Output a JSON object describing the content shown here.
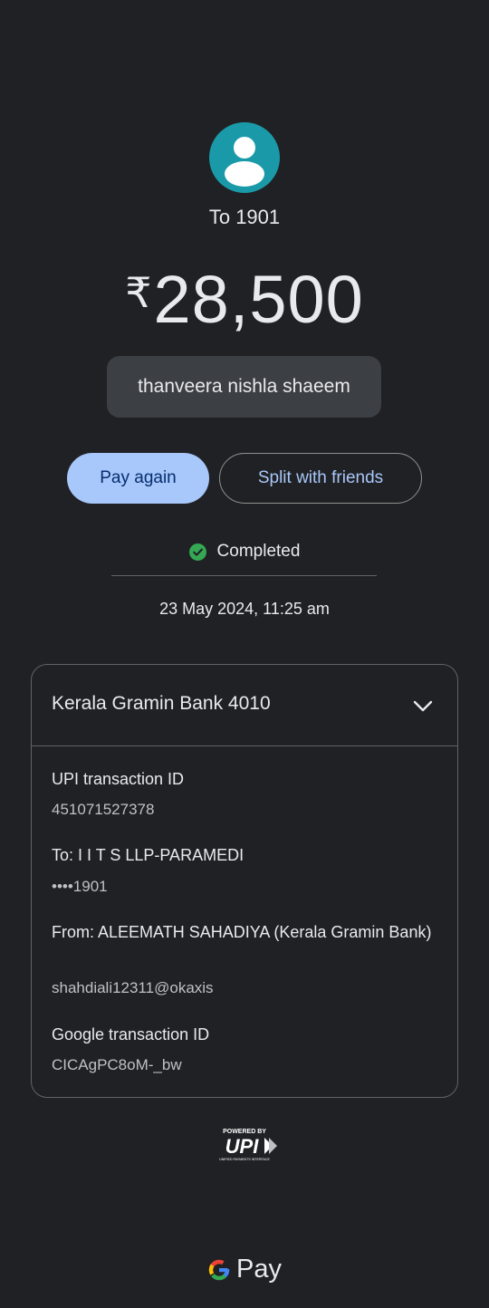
{
  "recipient": {
    "avatar_icon": "person-icon",
    "to_label": "To 1901"
  },
  "amount": {
    "currency_symbol": "₹",
    "value": "28,500"
  },
  "note": "thanveera nishla shaeem",
  "actions": {
    "pay_again": "Pay again",
    "split": "Split with friends"
  },
  "status": {
    "icon": "check-circle-icon",
    "text": "Completed",
    "color": "#34a853"
  },
  "datetime": "23 May 2024, 11:25 am",
  "details": {
    "bank": "Kerala Gramin Bank 4010",
    "upi_label": "UPI transaction ID",
    "upi_value": "451071527378",
    "to_label": "To: I I T S LLP-PARAMEDI",
    "to_value": "••••1901",
    "from_label": "From: ALEEMATH SAHADIYA (Kerala Gramin Bank)",
    "from_value": "shahdiali12311@okaxis",
    "google_label": "Google transaction ID",
    "google_value": "CICAgPC8oM-_bw"
  },
  "footer": {
    "powered_by": "POWERED BY",
    "upi_logo_text": "UPI",
    "upi_tagline": "UNIFIED PAYMENTS INTERFACE",
    "gpay_text": "Pay"
  },
  "colors": {
    "background": "#202124",
    "accent": "#a8c7fa",
    "avatar": "#1a9aa8"
  }
}
